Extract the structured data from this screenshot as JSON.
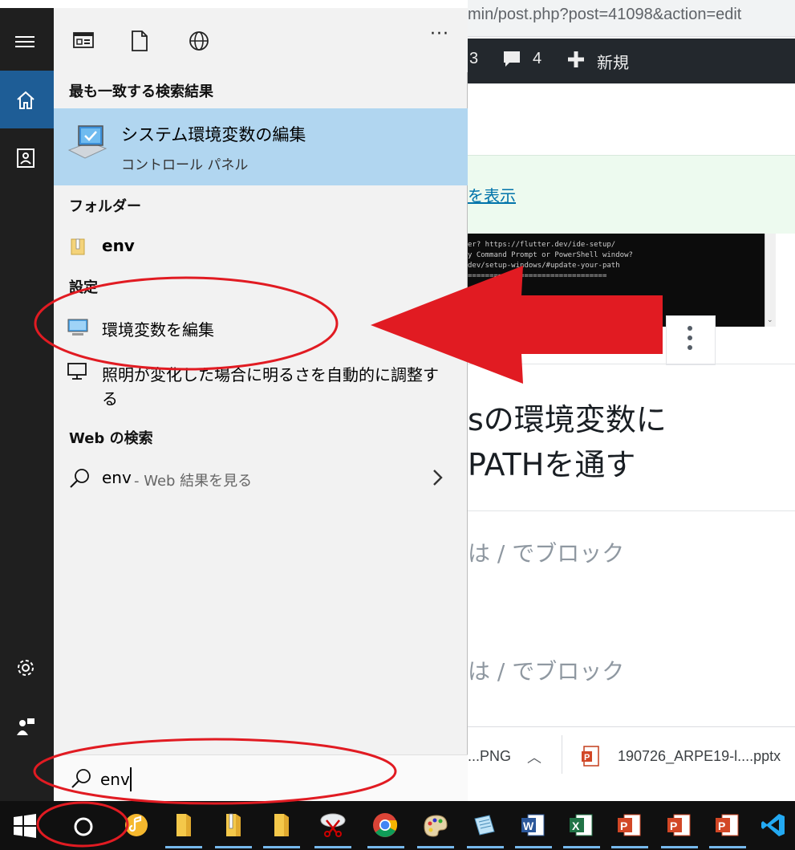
{
  "browser": {
    "url_text": "min/post.php?post=41098&action=edit",
    "wp_toolbar": {
      "updates_count": "3",
      "comments_count": "4",
      "new_label": "新規"
    },
    "notice_link": "を表示",
    "terminal_lines": [
      "er? https://flutter.dev/ide-setup/",
      "",
      "y Command Prompt or PowerShell window?",
      " dev/setup-windows/#update-your-path",
      "  ================================"
    ],
    "heading_line1": "sの環境変数に",
    "heading_line2": "PATHを通す",
    "placeholder1": "は / でブロック",
    "placeholder2": "は / でブロック",
    "downloads": [
      {
        "name": "...PNG"
      },
      {
        "name": "190726_ARPE19-l....pptx"
      }
    ]
  },
  "search": {
    "sections": {
      "best_match": "最も一致する検索結果",
      "folders": "フォルダー",
      "settings": "設定",
      "web": "Web の検索"
    },
    "best_match": {
      "title": "システム環境変数の編集",
      "subtitle": "コントロール パネル"
    },
    "folder_result": "env",
    "settings_results": [
      {
        "label": "環境変数を編集"
      },
      {
        "label_line1": "照明が変化した場合に明るさを自動的に調整す",
        "label_line2": "る"
      }
    ],
    "web_result": {
      "query": "env",
      "suffix": " - Web 結果を見る"
    },
    "query": "env",
    "more_label": "···"
  },
  "colors": {
    "accent": "#1e5d96",
    "best_match_bg": "#b1d6f0",
    "annotation_red": "#e11b22",
    "rail_bg": "#1f1f1f",
    "taskbar_bg": "#101010"
  },
  "taskbar_icons": [
    "windows-start-icon",
    "cortana-icon",
    "music-app-icon",
    "file-explorer-icon",
    "zip-folder-icon",
    "folder-icon",
    "snipping-tool-icon",
    "chrome-icon",
    "paint-icon",
    "notepad-icon",
    "word-icon",
    "excel-icon",
    "powerpoint-icon",
    "powerpoint-icon",
    "powerpoint-icon",
    "vscode-icon"
  ]
}
